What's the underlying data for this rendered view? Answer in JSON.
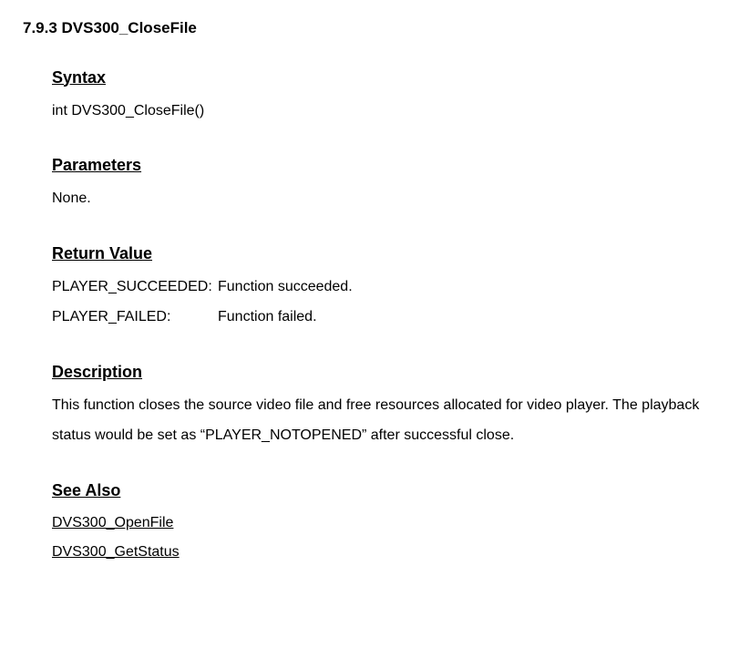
{
  "title": "7.9.3 DVS300_CloseFile",
  "syntax": {
    "heading": "Syntax",
    "code": "int DVS300_CloseFile()"
  },
  "parameters": {
    "heading": "Parameters",
    "text": "None."
  },
  "return_value": {
    "heading": "Return Value",
    "rows": [
      {
        "key": "PLAYER_SUCCEEDED:",
        "desc": "Function succeeded."
      },
      {
        "key": "PLAYER_FAILED:",
        "desc": "Function failed."
      }
    ]
  },
  "description": {
    "heading": "Description",
    "text": "This function closes the source video file and free resources allocated for video player. The playback status would be set as “PLAYER_NOTOPENED” after successful close."
  },
  "see_also": {
    "heading": "See Also",
    "links": [
      "DVS300_OpenFile",
      "DVS300_GetStatus"
    ]
  }
}
